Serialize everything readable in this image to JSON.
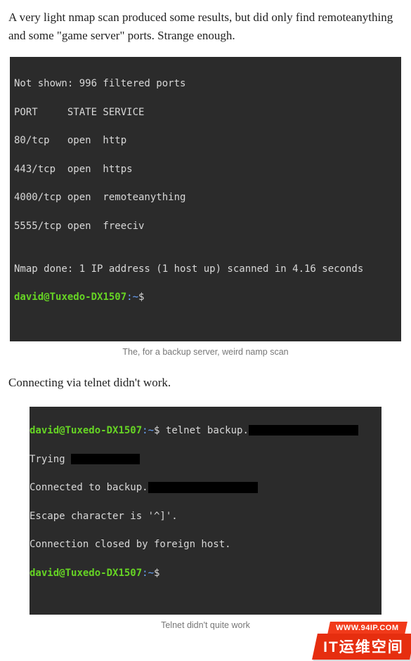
{
  "paragraphs": {
    "intro": "A very light nmap scan produced some results, but did only find remoteanything and some \"game server\" ports. Strange enough.",
    "telnet": "Connecting via telnet didn't work."
  },
  "captions": {
    "nmap": "The, for a backup server, weird namp scan",
    "telnet": "Telnet didn't quite work"
  },
  "term1": {
    "l1": "Not shown: 996 filtered ports",
    "l2": "PORT     STATE SERVICE",
    "l3": "80/tcp   open  http",
    "l4": "443/tcp  open  https",
    "l5": "4000/tcp open  remoteanything",
    "l6": "5555/tcp open  freeciv",
    "l7": "",
    "l8": "Nmap done: 1 IP address (1 host up) scanned in 4.16 seconds",
    "prompt_user": "david",
    "prompt_at": "@",
    "prompt_host": "Tuxedo-DX1507",
    "prompt_path": ":~",
    "prompt_dollar": "$"
  },
  "term2": {
    "cmd_prefix": "$ ",
    "cmd": "telnet backup.",
    "l2a": "Trying ",
    "l3a": "Connected to backup.",
    "l4": "Escape character is '^]'.",
    "l5": "Connection closed by foreign host.",
    "prompt_user": "david",
    "prompt_at": "@",
    "prompt_host": "Tuxedo-DX1507",
    "prompt_path": ":~",
    "prompt_dollar": "$"
  },
  "badge": {
    "url": "WWW.94IP.COM",
    "title": "IT运维空间"
  }
}
